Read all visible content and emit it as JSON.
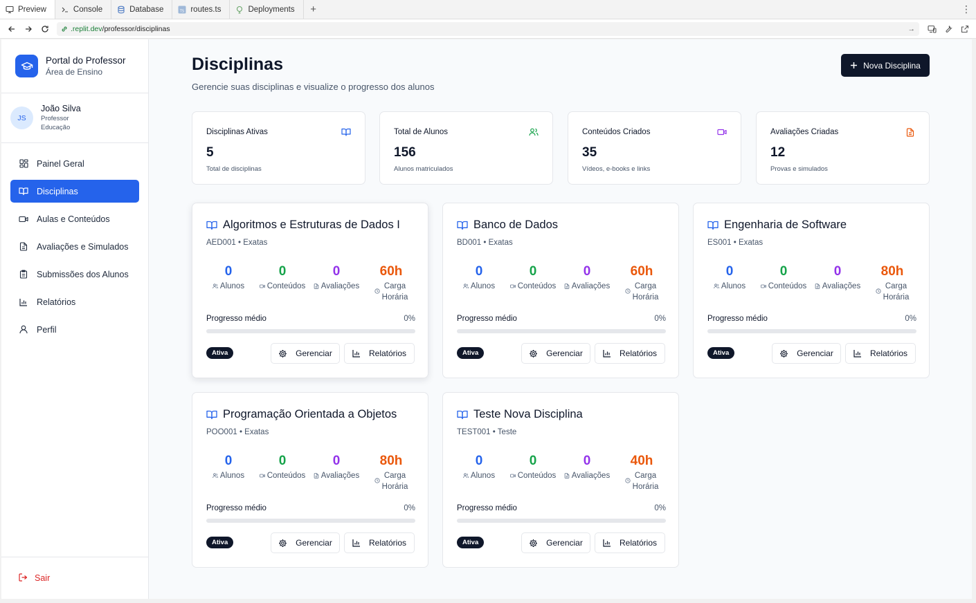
{
  "browser": {
    "tabs": [
      {
        "label": "Preview",
        "icon": "monitor-icon"
      },
      {
        "label": "Console",
        "icon": "terminal-icon"
      },
      {
        "label": "Database",
        "icon": "database-icon"
      },
      {
        "label": "routes.ts",
        "icon": "typescript-file-icon"
      },
      {
        "label": "Deployments",
        "icon": "deployments-icon"
      }
    ],
    "url_domain": ".replit.dev",
    "url_path": "/professor/disciplinas"
  },
  "sidebar": {
    "brand_title": "Portal do Professor",
    "brand_subtitle": "Área de Ensino",
    "user": {
      "initials": "JS",
      "name": "João Silva",
      "role": "Professor",
      "department": "Educação"
    },
    "items": [
      {
        "label": "Painel Geral",
        "icon": "dashboard-grid-icon",
        "active": false
      },
      {
        "label": "Disciplinas",
        "icon": "book-open-icon",
        "active": true
      },
      {
        "label": "Aulas e Conteúdos",
        "icon": "video-icon",
        "active": false
      },
      {
        "label": "Avaliações e Simulados",
        "icon": "file-text-icon",
        "active": false
      },
      {
        "label": "Submissões dos Alunos",
        "icon": "clipboard-icon",
        "active": false
      },
      {
        "label": "Relatórios",
        "icon": "bar-chart-icon",
        "active": false
      },
      {
        "label": "Perfil",
        "icon": "user-icon",
        "active": false
      }
    ],
    "logout_label": "Sair"
  },
  "main": {
    "title": "Disciplinas",
    "subtitle": "Gerencie suas disciplinas e visualize o progresso dos alunos",
    "new_button_label": "Nova Disciplina",
    "stats": [
      {
        "title": "Disciplinas Ativas",
        "value": "5",
        "desc": "Total de disciplinas",
        "icon": "book-open-icon",
        "color": "#2563eb"
      },
      {
        "title": "Total de Alunos",
        "value": "156",
        "desc": "Alunos matriculados",
        "icon": "users-icon",
        "color": "#16a34a"
      },
      {
        "title": "Conteúdos Criados",
        "value": "35",
        "desc": "Vídeos, e-books e links",
        "icon": "video-icon",
        "color": "#9333ea"
      },
      {
        "title": "Avaliações Criadas",
        "value": "12",
        "desc": "Provas e simulados",
        "icon": "file-text-icon",
        "color": "#ea580c"
      }
    ],
    "metric_labels": {
      "alunos": "Alunos",
      "conteudos": "Conteúdos",
      "avaliacoes": "Avaliações",
      "carga_line1": "Carga",
      "carga_line2": "Horária"
    },
    "progress_label": "Progresso médio",
    "manage_label": "Gerenciar",
    "reports_label": "Relatórios",
    "courses": [
      {
        "title": "Algoritmos e Estruturas de Dados I",
        "code": "AED001",
        "area": "Exatas",
        "alunos": "0",
        "conteudos": "0",
        "avaliacoes": "0",
        "carga": "60h",
        "progress": "0%",
        "progress_fraction": 0,
        "status": "Ativa"
      },
      {
        "title": "Banco de Dados",
        "code": "BD001",
        "area": "Exatas",
        "alunos": "0",
        "conteudos": "0",
        "avaliacoes": "0",
        "carga": "60h",
        "progress": "0%",
        "progress_fraction": 0,
        "status": "Ativa"
      },
      {
        "title": "Engenharia de Software",
        "code": "ES001",
        "area": "Exatas",
        "alunos": "0",
        "conteudos": "0",
        "avaliacoes": "0",
        "carga": "80h",
        "progress": "0%",
        "progress_fraction": 0,
        "status": "Ativa"
      },
      {
        "title": "Programação Orientada a Objetos",
        "code": "POO001",
        "area": "Exatas",
        "alunos": "0",
        "conteudos": "0",
        "avaliacoes": "0",
        "carga": "80h",
        "progress": "0%",
        "progress_fraction": 0,
        "status": "Ativa"
      },
      {
        "title": "Teste Nova Disciplina",
        "code": "TEST001",
        "area": "Teste",
        "alunos": "0",
        "conteudos": "0",
        "avaliacoes": "0",
        "carga": "40h",
        "progress": "0%",
        "progress_fraction": 0,
        "status": "Ativa"
      }
    ]
  },
  "colors": {
    "primary": "#2563eb",
    "dark": "#0f172a",
    "green": "#16a34a",
    "purple": "#9333ea",
    "orange": "#ea580c",
    "danger": "#dc2626"
  }
}
